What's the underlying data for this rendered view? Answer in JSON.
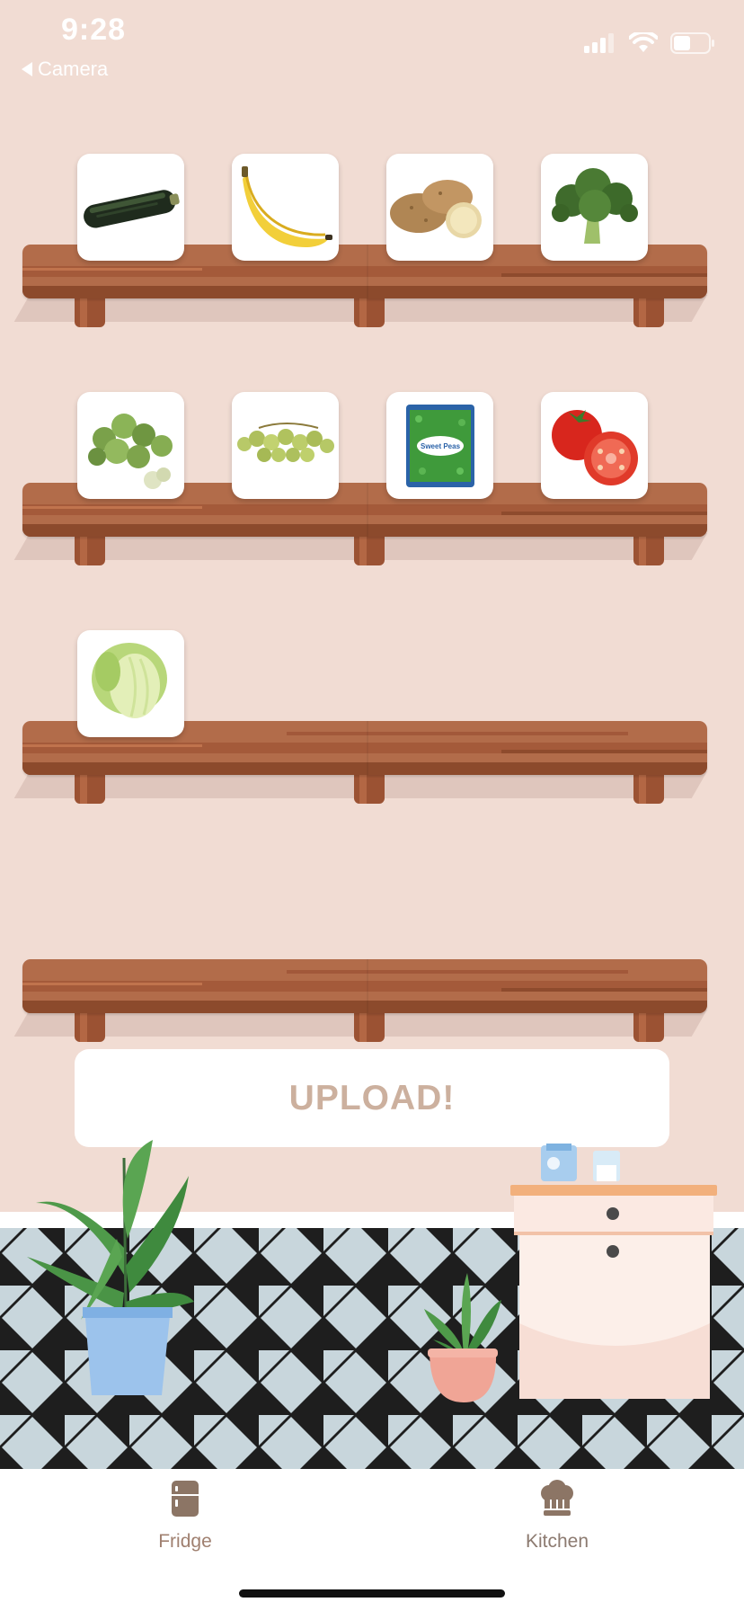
{
  "status_bar": {
    "time": "9:28",
    "back_label": "Camera"
  },
  "shelves": [
    {
      "items": [
        {
          "name": "zucchini"
        },
        {
          "name": "banana"
        },
        {
          "name": "potatoes"
        },
        {
          "name": "broccoli"
        }
      ]
    },
    {
      "items": [
        {
          "name": "brussels-sprouts"
        },
        {
          "name": "green-grapes"
        },
        {
          "name": "frozen-sweet-peas",
          "package_label": "Sweet Peas"
        },
        {
          "name": "tomatoes"
        }
      ]
    },
    {
      "items": [
        {
          "name": "iceberg-lettuce"
        }
      ]
    },
    {
      "items": []
    }
  ],
  "upload_button": {
    "label": "UPLOAD!"
  },
  "tab_bar": {
    "tabs": [
      {
        "label": "Fridge",
        "icon": "fridge-icon"
      },
      {
        "label": "Kitchen",
        "icon": "chef-hat-icon"
      }
    ]
  },
  "colors": {
    "wall": "#f1dcd3",
    "shelf_wood": "#b26c4a",
    "upload_text": "#ccb09e",
    "tab_label": "#a08070"
  }
}
